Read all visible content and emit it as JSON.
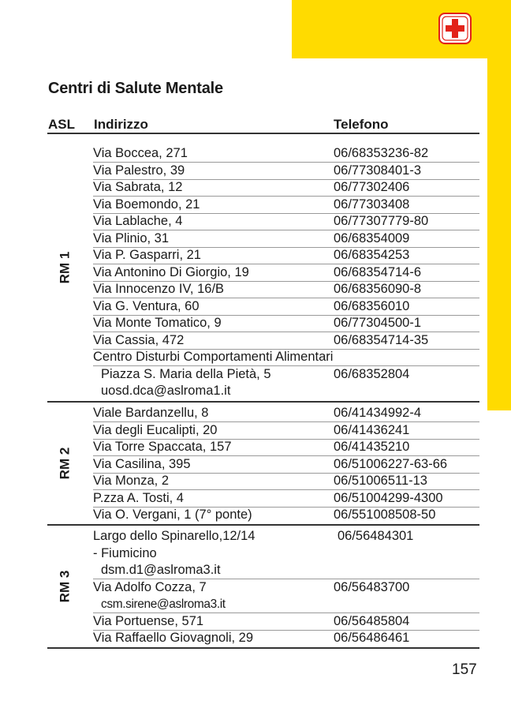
{
  "page": {
    "title": "Centri di Salute Mentale",
    "page_number": "157",
    "accent_color": "#ffdb00",
    "icon": "first-aid-cross-icon"
  },
  "table": {
    "headers": {
      "asl": "ASL",
      "address": "Indirizzo",
      "phone": "Telefono"
    },
    "groups": [
      {
        "label": "RM 1",
        "rows": [
          {
            "address": "Via Boccea, 271",
            "phone": "06/68353236-82"
          },
          {
            "address": "Via Palestro, 39",
            "phone": "06/77308401-3"
          },
          {
            "address": "Via Sabrata, 12",
            "phone": "06/77302406"
          },
          {
            "address": "Via Boemondo, 21",
            "phone": "06/77303408"
          },
          {
            "address": "Via Lablache, 4",
            "phone": "06/77307779-80"
          },
          {
            "address": "Via Plinio, 31",
            "phone": "06/68354009"
          },
          {
            "address": "Via P. Gasparri, 21",
            "phone": "06/68354253"
          },
          {
            "address": "Via Antonino Di Giorgio, 19",
            "phone": "06/68354714-6"
          },
          {
            "address": "Via Innocenzo IV, 16/B",
            "phone": "06/68356090-8"
          },
          {
            "address": "Via G. Ventura, 60",
            "phone": "06/68356010"
          },
          {
            "address": "Via Monte Tomatico, 9",
            "phone": "06/77304500-1"
          },
          {
            "address": "Via Cassia, 472",
            "phone": "06/68354714-35"
          },
          {
            "address": "Centro Disturbi Comportamenti Alimentari",
            "phone": ""
          },
          {
            "address": "Piazza S. Maria della Pietà, 5",
            "phone": "06/68352804"
          },
          {
            "address": "uosd.dca@aslroma1.it",
            "phone": ""
          }
        ]
      },
      {
        "label": "RM 2",
        "rows": [
          {
            "address": "Viale Bardanzellu, 8",
            "phone": "06/41434992-4"
          },
          {
            "address": "Via degli Eucalipti, 20",
            "phone": "06/41436241"
          },
          {
            "address": "Via Torre Spaccata, 157",
            "phone": "06/41435210"
          },
          {
            "address": "Via Casilina, 395",
            "phone": "06/51006227-63-66"
          },
          {
            "address": "Via Monza, 2",
            "phone": "06/51006511-13"
          },
          {
            "address": "P.zza A. Tosti, 4",
            "phone": "06/51004299-4300"
          },
          {
            "address": "Via O. Vergani, 1 (7° ponte)",
            "phone": "06/551008508-50"
          }
        ]
      },
      {
        "label": "RM 3",
        "rows": [
          {
            "address": "Largo dello Spinarello,12/14",
            "phone": "06/56484301"
          },
          {
            "address": "- Fiumicino",
            "phone": ""
          },
          {
            "address": "dsm.d1@aslroma3.it",
            "phone": ""
          },
          {
            "address": "Via Adolfo Cozza, 7",
            "phone": "06/56483700"
          },
          {
            "address": "csm.sirene@aslroma3.it",
            "phone": ""
          },
          {
            "address": "Via Portuense, 571",
            "phone": "06/56485804"
          },
          {
            "address": "Via Raffaello Giovagnoli, 29",
            "phone": "06/56486461"
          }
        ]
      }
    ]
  }
}
